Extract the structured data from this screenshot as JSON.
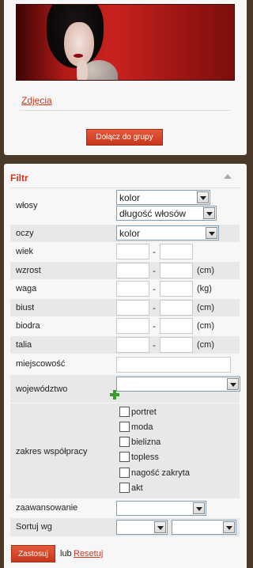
{
  "group": {
    "photos_link": "Zdjęcia",
    "join_button": "Dołącz do grupy"
  },
  "filter": {
    "title": "Filtr",
    "rows": {
      "hair": {
        "label": "włosy",
        "select1": "kolor",
        "select2": "długość włosów"
      },
      "eyes": {
        "label": "oczy",
        "select": "kolor"
      },
      "age": {
        "label": "wiek",
        "dash": "-"
      },
      "height": {
        "label": "wzrost",
        "dash": "-",
        "unit": "(cm)"
      },
      "weight": {
        "label": "waga",
        "dash": "-",
        "unit": "(kg)"
      },
      "bust": {
        "label": "biust",
        "dash": "-",
        "unit": "(cm)"
      },
      "hips": {
        "label": "biodra",
        "dash": "-",
        "unit": "(cm)"
      },
      "waist": {
        "label": "talia",
        "dash": "-",
        "unit": "(cm)"
      },
      "city": {
        "label": "miejscowość"
      },
      "province": {
        "label": "województwo"
      },
      "cooperation": {
        "label": "zakres współpracy",
        "options": [
          "portret",
          "moda",
          "bielizna",
          "topless",
          "nagość zakryta",
          "akt"
        ]
      },
      "advanced": {
        "label": "zaawansowanie"
      },
      "sort": {
        "label": "Sortuj wg"
      }
    },
    "apply_button": "Zastosuj",
    "or_text": "lub",
    "reset_link": "Resetuj"
  },
  "colors": {
    "accent": "#d0361f",
    "background": "#4a3828",
    "panel": "#f7f7f7"
  }
}
